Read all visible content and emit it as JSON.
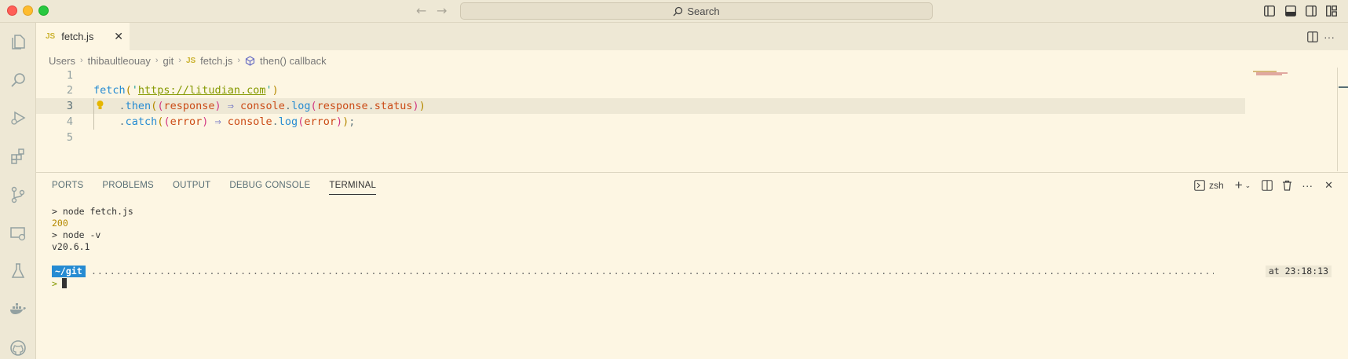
{
  "window": {
    "search_placeholder": "Search"
  },
  "tab": {
    "badge": "JS",
    "filename": "fetch.js",
    "close": "✕"
  },
  "breadcrumb": {
    "parts": [
      "Users",
      "thibaultleouay",
      "git",
      "fetch.js",
      "then() callback"
    ],
    "file_badge": "JS"
  },
  "editor": {
    "line_numbers": [
      "1",
      "2",
      "3",
      "4",
      "5"
    ],
    "active_line": 3,
    "lines": {
      "l2": {
        "fetch": "fetch",
        "open": "(",
        "quote1": "'",
        "url": "https://litudian.com",
        "quote2": "'",
        "close": ")"
      },
      "l3": {
        "indent": "    ",
        "dot": ".",
        "method": "then",
        "p1": "(",
        "p2": "(",
        "param": "response",
        "p3": ")",
        "arrow": " ⇒ ",
        "obj": "console",
        "dot2": ".",
        "fn": "log",
        "p4": "(",
        "arg": "response",
        "dot3": ".",
        "prop": "status",
        "p5": ")",
        "p6": ")"
      },
      "l4": {
        "indent": "    ",
        "dot": ".",
        "method": "catch",
        "p1": "(",
        "p2": "(",
        "param": "error",
        "p3": ")",
        "arrow": " ⇒ ",
        "obj": "console",
        "dot2": ".",
        "fn": "log",
        "p4": "(",
        "arg": "error",
        "p5": ")",
        "p6": ")",
        "semi": ";"
      }
    }
  },
  "panel": {
    "tabs": [
      "PORTS",
      "PROBLEMS",
      "OUTPUT",
      "DEBUG CONSOLE",
      "TERMINAL"
    ],
    "active_tab": "TERMINAL",
    "shell": "zsh",
    "close": "✕"
  },
  "terminal": {
    "lines": [
      "> node fetch.js",
      "200",
      "> node -v",
      "v20.6.1"
    ],
    "prompt_dir": "~/git",
    "prompt_dots": "..............................................................................................................................................................................................................................",
    "time": "at 23:18:13",
    "prompt_char": ">"
  },
  "colors": {
    "background": "#fdf6e3",
    "chrome": "#eee8d5",
    "accent_blue": "#268bd2"
  }
}
